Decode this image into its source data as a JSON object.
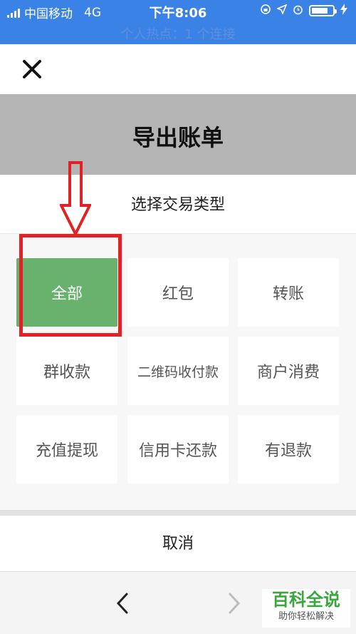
{
  "status_bar": {
    "carrier": "中国移动",
    "network": "4G",
    "time": "下午8:06",
    "hotspot": "个人热点：1 个连接",
    "battery_level": 0.7
  },
  "header": {
    "title": "导出账单"
  },
  "sheet": {
    "subtitle": "选择交易类型",
    "options": [
      {
        "label": "全部",
        "selected": true
      },
      {
        "label": "红包"
      },
      {
        "label": "转账"
      },
      {
        "label": "群收款"
      },
      {
        "label": "二维码收付款"
      },
      {
        "label": "商户消费"
      },
      {
        "label": "充值提现"
      },
      {
        "label": "信用卡还款"
      },
      {
        "label": "有退款"
      }
    ],
    "cancel_label": "取消"
  },
  "watermark": {
    "main": "百科全说",
    "sub": "助你轻松解决"
  },
  "colors": {
    "status_bar": "#3b82e6",
    "selected_option": "#69b26e",
    "annotation_red": "#e32023"
  }
}
